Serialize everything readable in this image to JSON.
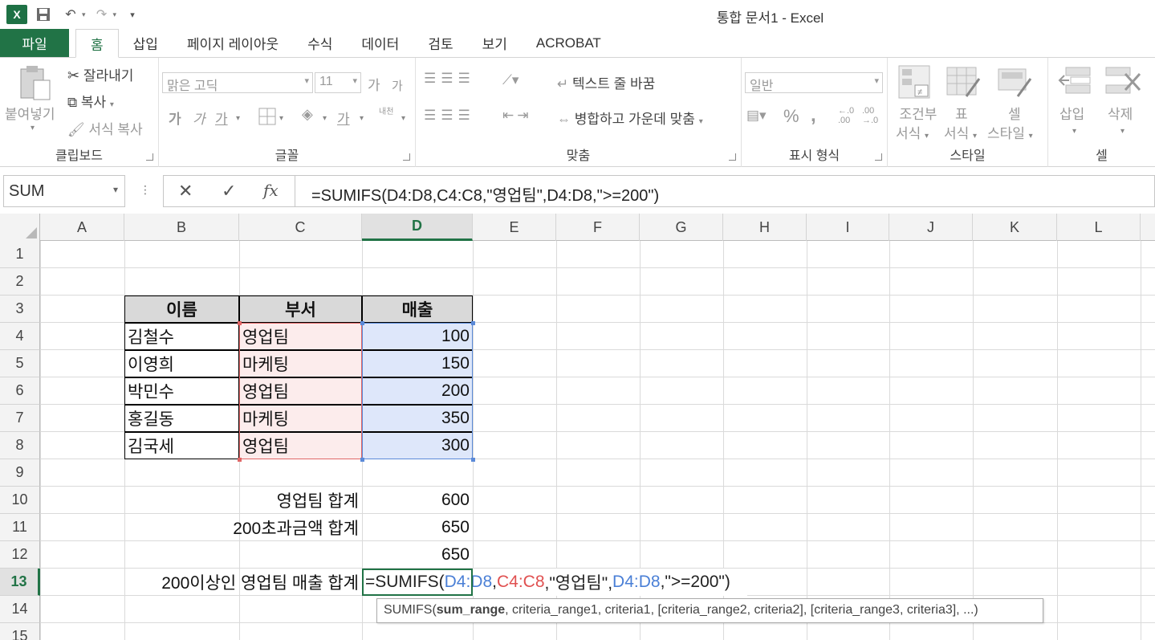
{
  "window": {
    "title": "통합 문서1 - Excel",
    "app_icon_letter": "X"
  },
  "tabs": [
    {
      "label": "파일"
    },
    {
      "label": "홈"
    },
    {
      "label": "삽입"
    },
    {
      "label": "페이지 레이아웃"
    },
    {
      "label": "수식"
    },
    {
      "label": "데이터"
    },
    {
      "label": "검토"
    },
    {
      "label": "보기"
    },
    {
      "label": "ACROBAT"
    }
  ],
  "ribbon": {
    "clipboard": {
      "label": "클립보드",
      "paste": "붙여넣기",
      "cut": "잘라내기",
      "copy": "복사",
      "format_painter": "서식 복사"
    },
    "font": {
      "label": "글꼴",
      "font_name": "맑은 고딕",
      "font_size": "11",
      "grow": "가",
      "shrink": "가",
      "bold": "가",
      "italic": "가",
      "underline": "가",
      "font_color": "가",
      "phonetic": "내천"
    },
    "alignment": {
      "label": "맞춤",
      "wrap_text": "텍스트 줄 바꿈",
      "merge_center": "병합하고 가운데 맞춤"
    },
    "number": {
      "label": "표시 형식",
      "format": "일반",
      "percent": "%",
      "comma": ",",
      "inc_decimal": "←.0 .00",
      "dec_decimal": ".00 →.0"
    },
    "styles": {
      "label": "스타일",
      "conditional_line1": "조건부",
      "conditional_line2": "서식",
      "table_line1": "표",
      "table_line2": "서식",
      "cell_line1": "셀",
      "cell_line2": "스타일"
    },
    "cells": {
      "label": "셀",
      "insert": "삽입",
      "delete": "삭제"
    }
  },
  "formula_bar": {
    "name_box": "SUM",
    "fx": "fx",
    "formula": "=SUMIFS(D4:D8,C4:C8,\"영업팀\",D4:D8,\">=200\")"
  },
  "columns": [
    "A",
    "B",
    "C",
    "D",
    "E",
    "F",
    "G",
    "H",
    "I",
    "J",
    "K",
    "L"
  ],
  "rows": [
    "1",
    "2",
    "3",
    "4",
    "5",
    "6",
    "7",
    "8",
    "9",
    "10",
    "11",
    "12",
    "13",
    "14",
    "15"
  ],
  "active": {
    "column": "D",
    "row": "13"
  },
  "table": {
    "headers": [
      "이름",
      "부서",
      "매출"
    ],
    "rows": [
      [
        "김철수",
        "영업팀",
        "100"
      ],
      [
        "이영희",
        "마케팅",
        "150"
      ],
      [
        "박민수",
        "영업팀",
        "200"
      ],
      [
        "홍길동",
        "마케팅",
        "350"
      ],
      [
        "김국세",
        "영업팀",
        "300"
      ]
    ]
  },
  "summary": [
    {
      "label": "영업팀 합계",
      "value": "600"
    },
    {
      "label": "200초과금액 합계",
      "value": "650"
    },
    {
      "label": "",
      "value": "650"
    }
  ],
  "editing": {
    "label": "200이상인 영업팀 매출 합계",
    "parts": [
      {
        "text": "=SUMIFS(",
        "color": "#222222"
      },
      {
        "text": "D4:D8",
        "color": "#4a7fd6"
      },
      {
        "text": ",",
        "color": "#222222"
      },
      {
        "text": "C4:C8",
        "color": "#e05050"
      },
      {
        "text": ",\"영업팀\",",
        "color": "#222222"
      },
      {
        "text": "D4:D8",
        "color": "#4a7fd6"
      },
      {
        "text": ",\">=200\")",
        "color": "#222222"
      }
    ]
  },
  "tooltip": {
    "prefix": "SUMIFS(",
    "bold_arg": "sum_range",
    "rest": ", criteria_range1, criteria1, [criteria_range2, criteria2], [criteria_range3, criteria3], ...)"
  },
  "colors": {
    "accent": "#217346",
    "range_c": "#e06666",
    "range_d": "#5b8ad8"
  }
}
